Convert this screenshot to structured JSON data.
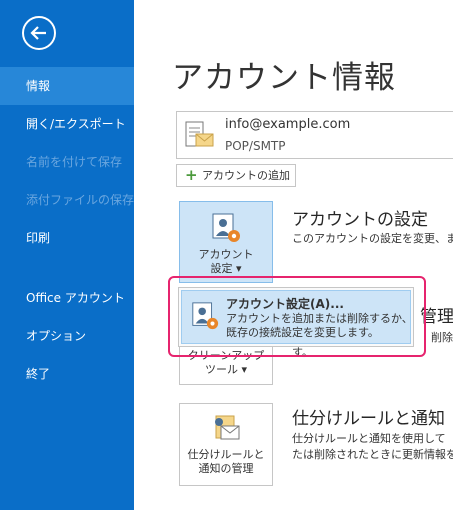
{
  "sidebar": {
    "items": [
      {
        "label": "情報"
      },
      {
        "label": "開く/エクスポート"
      },
      {
        "label": "名前を付けて保存"
      },
      {
        "label": "添付ファイルの保存"
      },
      {
        "label": "印刷"
      },
      {
        "label": "Office アカウント"
      },
      {
        "label": "オプション"
      },
      {
        "label": "終了"
      }
    ]
  },
  "main": {
    "title": "アカウント情報",
    "account": {
      "email": "info@example.com",
      "type": "POP/SMTP"
    },
    "add_account_label": "アカウントの追加",
    "sections": [
      {
        "button_line1": "アカウント",
        "button_line2": "設定 ▾",
        "heading": "アカウントの設定",
        "desc": "このアカウントの設定を変更、または"
      },
      {
        "button_line1": "クリーンアップ",
        "button_line2": "ツール ▾",
        "heading": "管理",
        "desc1": "削除や",
        "desc2": "す。"
      },
      {
        "button_line1": "仕分けルールと",
        "button_line2": "通知の管理",
        "heading": "仕分けルールと通知",
        "desc1": "仕分けルールと通知を使用して",
        "desc2": "たは削除されたときに更新情報を"
      }
    ]
  },
  "dropdown": {
    "title": "アカウント設定(A)...",
    "desc1": "アカウントを追加または削除するか、",
    "desc2": "既存の接続設定を変更します。"
  },
  "colors": {
    "sidebar": "#0a6ec8",
    "sidebar_active": "#2787d8",
    "highlight": "#e6246e",
    "selected": "#cde4f7"
  }
}
